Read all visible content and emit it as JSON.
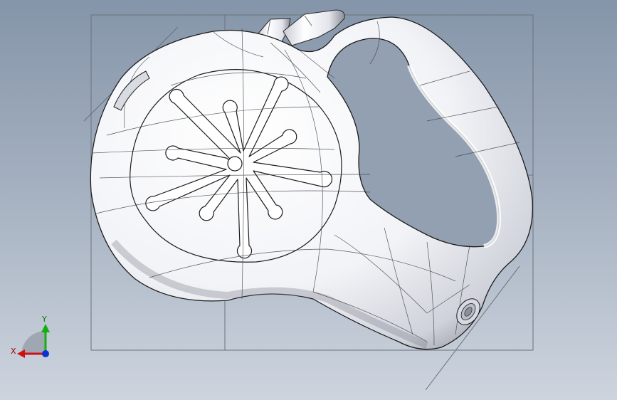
{
  "viewport": {
    "background_top": "#8595a9",
    "background_bottom": "#cdd4de",
    "model": "retractable-leash-housing",
    "render_style": "shaded-with-edges"
  },
  "triad": {
    "x_label": "X",
    "y_label": "Y",
    "x_color": "#d01010",
    "y_color": "#10b010",
    "z_color": "#1030d0"
  }
}
